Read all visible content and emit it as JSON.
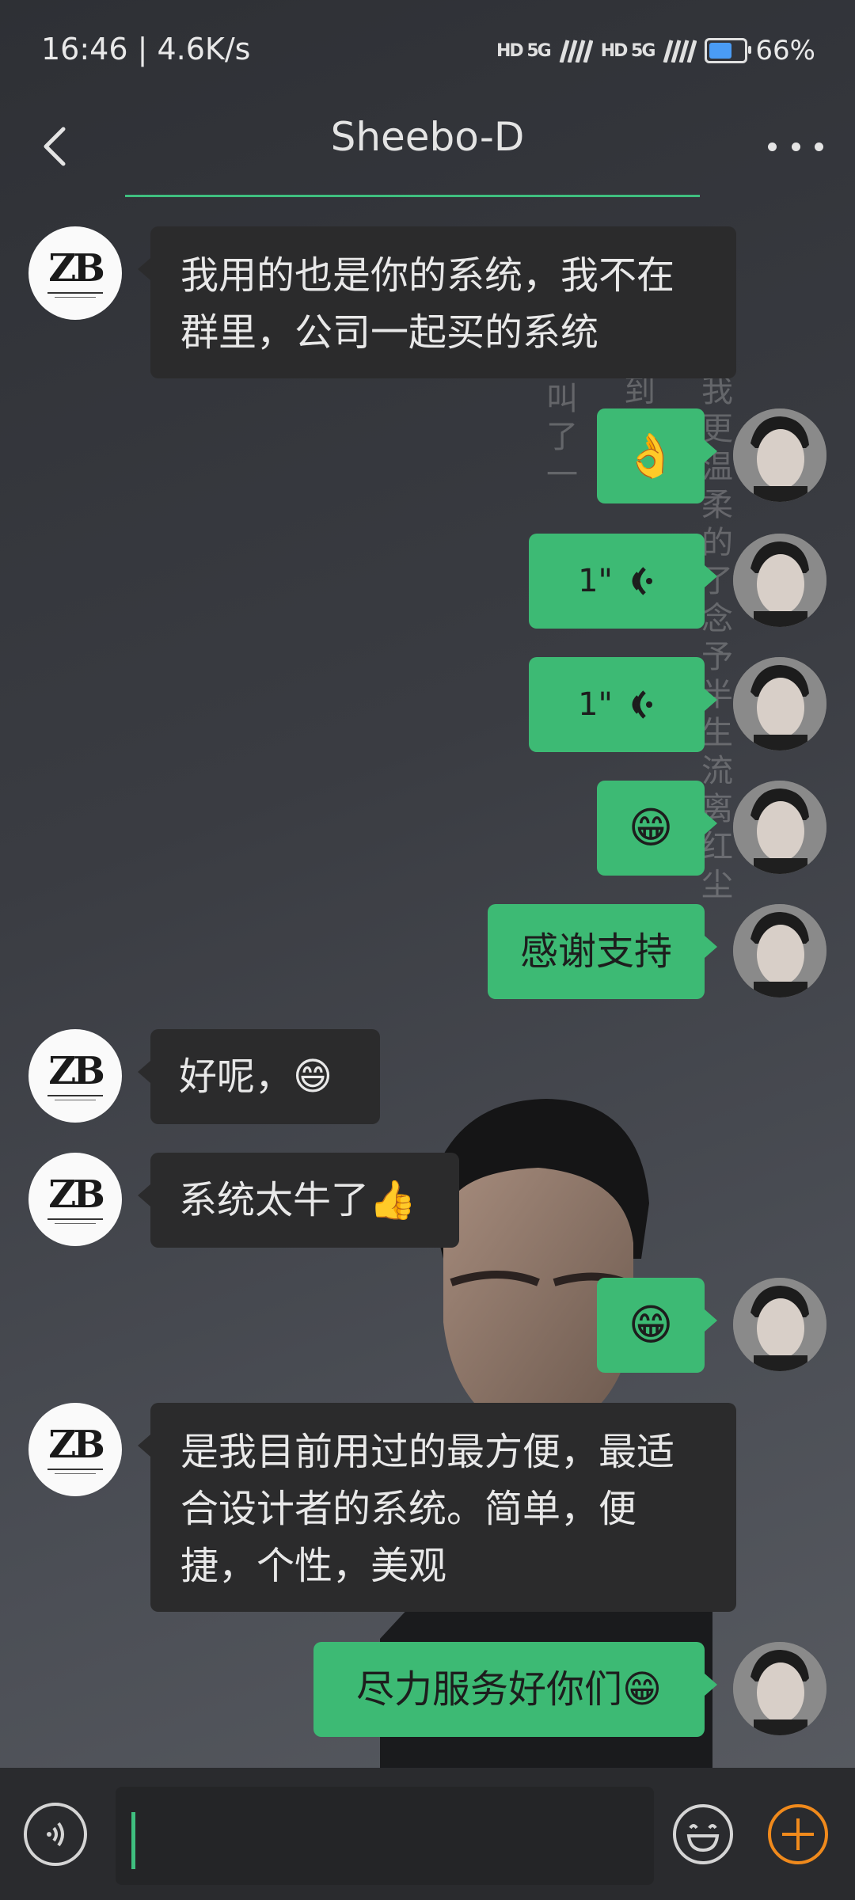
{
  "status_bar": {
    "time": "16:46 | 4.6K/s",
    "signal_1": "HD 5G",
    "signal_2": "HD 5G",
    "battery_percent": "66%",
    "battery_level": 0.66
  },
  "header": {
    "title": "Sheebo-D"
  },
  "background_text": {
    "col1": "叫了一",
    "col2": "到似柔",
    "col3": "我更温柔的了念予半生流离红尘"
  },
  "messages": [
    {
      "side": "in",
      "text": "我用的也是你的系统，我不在群里，公司一起买的系统"
    },
    {
      "side": "out",
      "text": "👌"
    },
    {
      "side": "out",
      "text": "1\"",
      "type": "voice"
    },
    {
      "side": "out",
      "text": "1\"",
      "type": "voice"
    },
    {
      "side": "out",
      "text": "😁"
    },
    {
      "side": "out",
      "text": "感谢支持"
    },
    {
      "side": "in",
      "text": "好呢，😄"
    },
    {
      "side": "in",
      "text": "系统太牛了👍"
    },
    {
      "side": "out",
      "text": "😁"
    },
    {
      "side": "in",
      "text": "是我目前用过的最方便，最适合设计者的系统。简单，便捷，个性，美观"
    },
    {
      "side": "out",
      "text": "尽力服务好你们😁"
    }
  ],
  "colors": {
    "accent": "#3dba74",
    "incoming_bubble": "#2b2b2c",
    "plus_button": "#f08a1c"
  },
  "logo_mark": "ZB"
}
